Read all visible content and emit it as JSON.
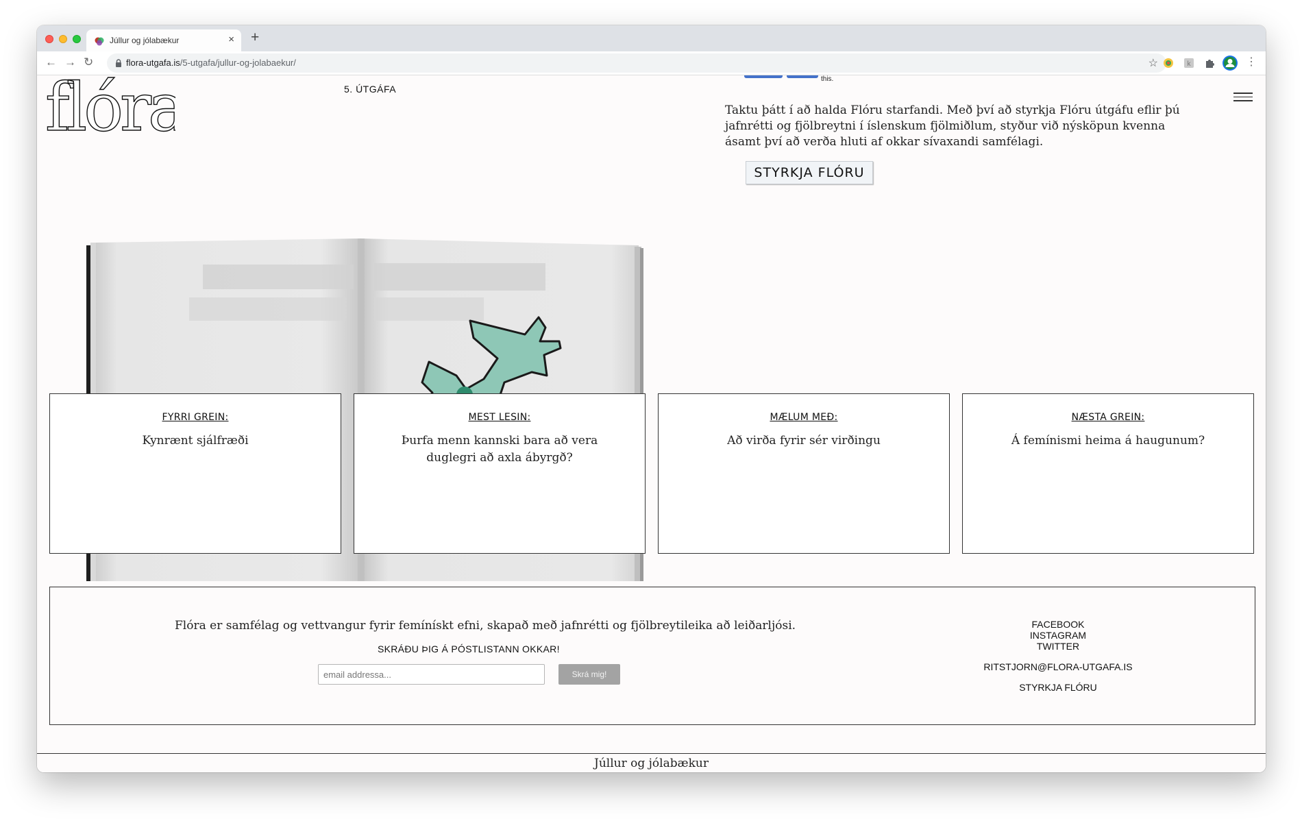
{
  "browser": {
    "tab_title": "Júllur og jólabækur",
    "new_tab_symbol": "+",
    "close_tab_symbol": "×",
    "url_host": "flora-utgafa.is",
    "url_path": "/5-utgafa/jullur-og-jolabaekur/",
    "icons": [
      "back-icon",
      "forward-icon",
      "reload-icon",
      "lock-icon",
      "star-icon",
      "extension-icon",
      "puzzle-icon",
      "profile-icon",
      "more-icon"
    ]
  },
  "header": {
    "logo_text": "flóra",
    "issue": "5. ÚTGÁFA",
    "fb_share_fragment": "this.",
    "support_text": "Taktu þátt í að halda Flóru starfandi. Með því að styrkja Flóru útgáfu eflir þú jafnrétti og fjölbreytni í íslenskum fjölmiðlum, styður við nýsköpun kvenna ásamt því að verða hluti af okkar sívaxandi samfélagi.",
    "support_button": "STYRKJA FLÓRU"
  },
  "cards": [
    {
      "label": "FYRRI GREIN:",
      "title": "Kynrænt sjálfræði"
    },
    {
      "label": "MEST LESIN:",
      "title": "Þurfa menn kannski bara að vera duglegri að axla ábyrgð?"
    },
    {
      "label": "MÆLUM MEÐ:",
      "title": "Að virða fyrir sér virðingu"
    },
    {
      "label": "NÆSTA GREIN:",
      "title": "Á femínismi heima á haugunum?"
    }
  ],
  "footer": {
    "tagline": "Flóra er samfélag og vettvangur fyrir femínískt efni, skapað með jafnrétti og fjölbreytileika að leiðarljósi.",
    "newsletter_label": "SKRÁÐU ÞIG Á PÓSTLISTANN OKKAR!",
    "email_placeholder": "email addressa...",
    "submit_label": "Skrá mig!",
    "links": {
      "facebook": "FACEBOOK",
      "instagram": "INSTAGRAM",
      "twitter": "TWITTER",
      "email": "RITSTJORN@FLORA-UTGAFA.IS",
      "support": "STYRKJA FLÓRU"
    }
  },
  "bottom_title": "Júllur og jólabækur",
  "colors": {
    "page_bg": "#fdfbfb",
    "card_border": "#333333",
    "button_grey": "#a3a3a3",
    "fb_blue": "#4472ca",
    "illustration_green": "#8ec7b6"
  }
}
